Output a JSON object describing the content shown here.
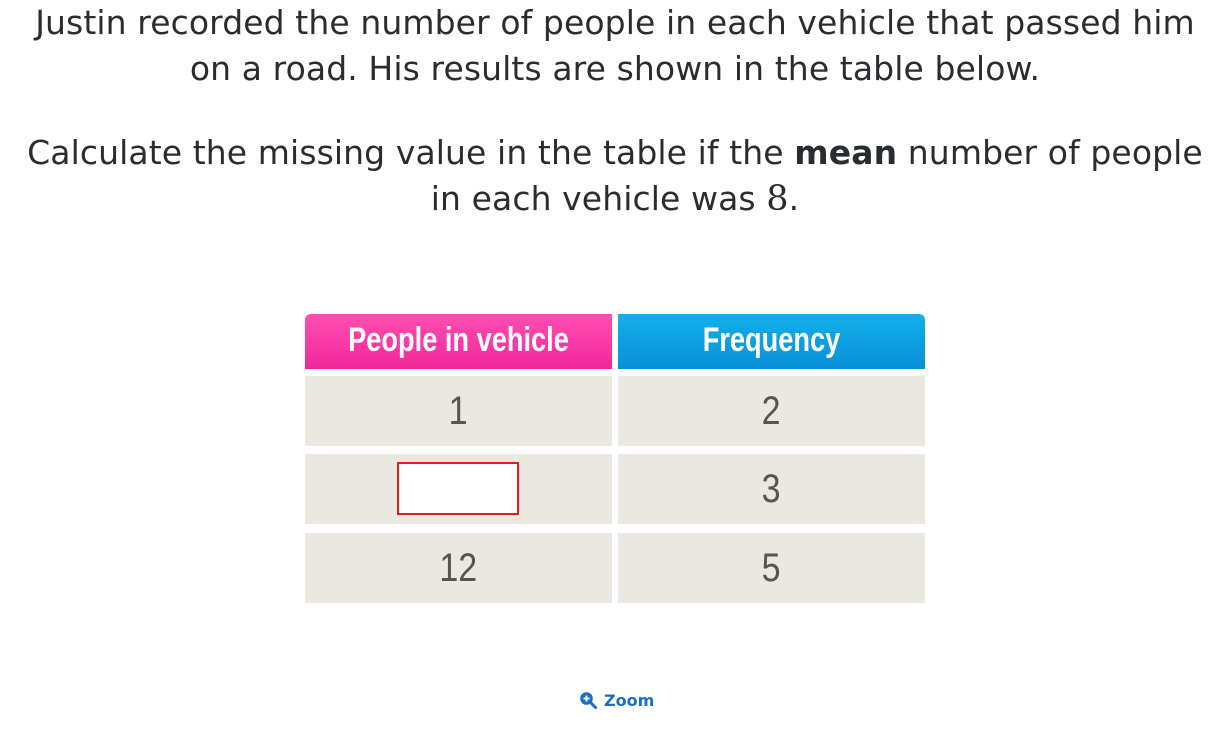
{
  "question": {
    "line1": "Justin recorded the number of people in each vehicle that passed him",
    "line2": "on a road. His results are shown in the table below.",
    "line3_pre": "Calculate the missing value in the table if the ",
    "line3_bold": "mean",
    "line3_post": " number of people",
    "line4_pre": "in each vehicle was ",
    "line4_num": "8",
    "line4_post": "."
  },
  "table": {
    "headers": [
      "People in vehicle",
      "Frequency"
    ],
    "header_colors": [
      "#f0279a",
      "#0a8fd6"
    ],
    "rows": [
      {
        "people": "1",
        "frequency": "2"
      },
      {
        "people": "",
        "frequency": "3"
      },
      {
        "people": "12",
        "frequency": "5"
      }
    ]
  },
  "answer_input": {
    "value": "",
    "border_color": "#e02020"
  },
  "zoom": {
    "label": "Zoom",
    "icon": "zoom-in-icon"
  }
}
